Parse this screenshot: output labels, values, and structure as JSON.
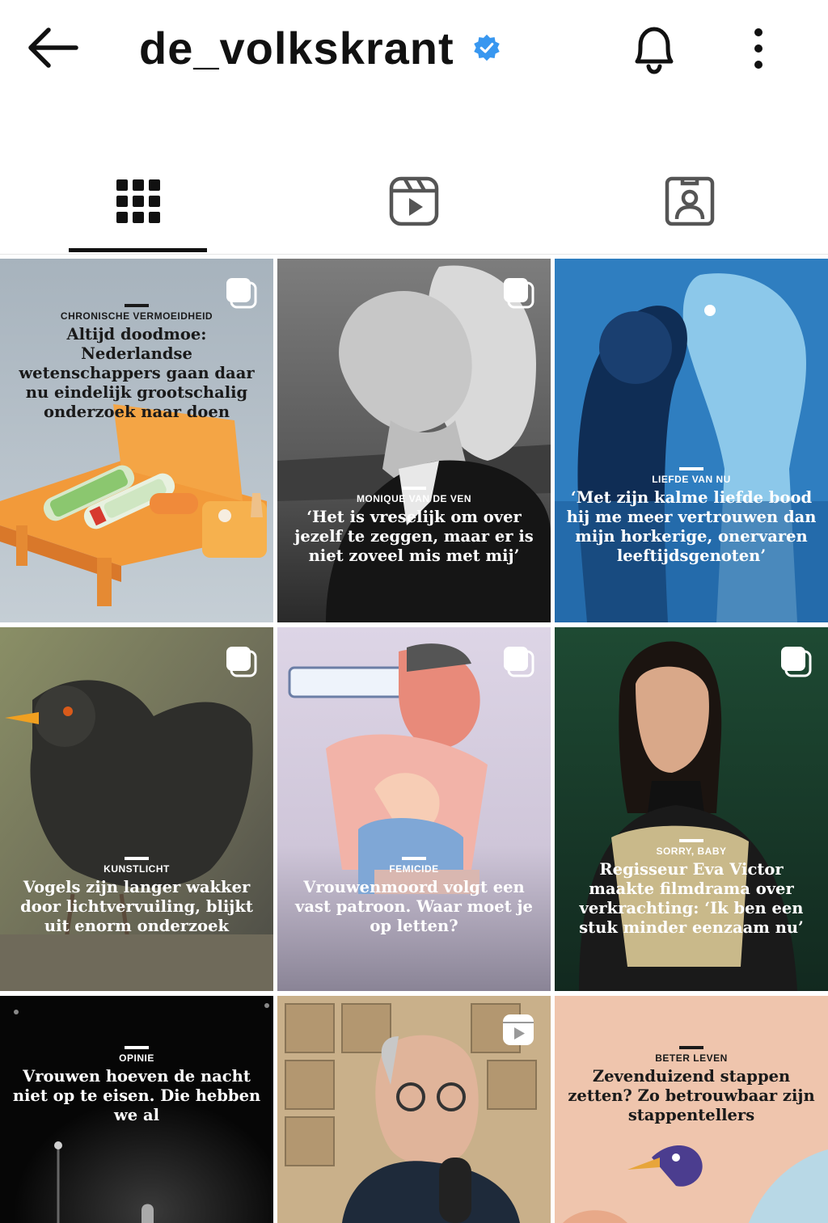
{
  "header": {
    "username": "de_volkskrant",
    "verified_icon": "verified-badge-icon",
    "accent_color": "#3897f0"
  },
  "tabs": [
    {
      "name": "posts",
      "icon": "grid-icon",
      "selected": true
    },
    {
      "name": "reels",
      "icon": "reels-icon",
      "selected": false
    },
    {
      "name": "tagged",
      "icon": "tagged-person-icon",
      "selected": false
    }
  ],
  "posts": [
    {
      "kicker": "CHRONISCHE VERMOEIDHEID",
      "headline": "Altijd doodmoe: Nederlandse wetenschappers gaan daar nu eindelijk grootschalig onderzoek naar doen",
      "type": "carousel"
    },
    {
      "kicker": "MONIQUE VAN DE VEN",
      "headline": "‘Het is vreselijk om over jezelf te zeggen, maar er is niet zoveel mis met mij’",
      "type": "carousel"
    },
    {
      "kicker": "LIEFDE VAN NU",
      "headline": "‘Met zijn kalme liefde bood hij me meer vertrouwen dan mijn horkerige, onervaren leeftijdsgenoten’",
      "type": "single"
    },
    {
      "kicker": "KUNSTLICHT",
      "headline": "Vogels zijn langer wakker door lichtvervuiling, blijkt uit enorm onderzoek",
      "type": "carousel"
    },
    {
      "kicker": "FEMICIDE",
      "headline": "Vrouwenmoord volgt een vast patroon. Waar moet je op letten?",
      "type": "carousel"
    },
    {
      "kicker": "SORRY, BABY",
      "headline": "Regisseur Eva Victor maakte filmdrama over verkrachting: ‘Ik ben een stuk minder eenzaam nu’",
      "type": "carousel"
    },
    {
      "kicker": "OPINIE",
      "headline": "Vrouwen hoeven de nacht niet op te eisen. Die hebben we al",
      "type": "single"
    },
    {
      "kicker": "",
      "headline": "",
      "type": "reel"
    },
    {
      "kicker": "BETER LEVEN",
      "headline": "Zevenduizend stappen zetten? Zo betrouwbaar zijn stappentellers",
      "type": "single"
    }
  ]
}
